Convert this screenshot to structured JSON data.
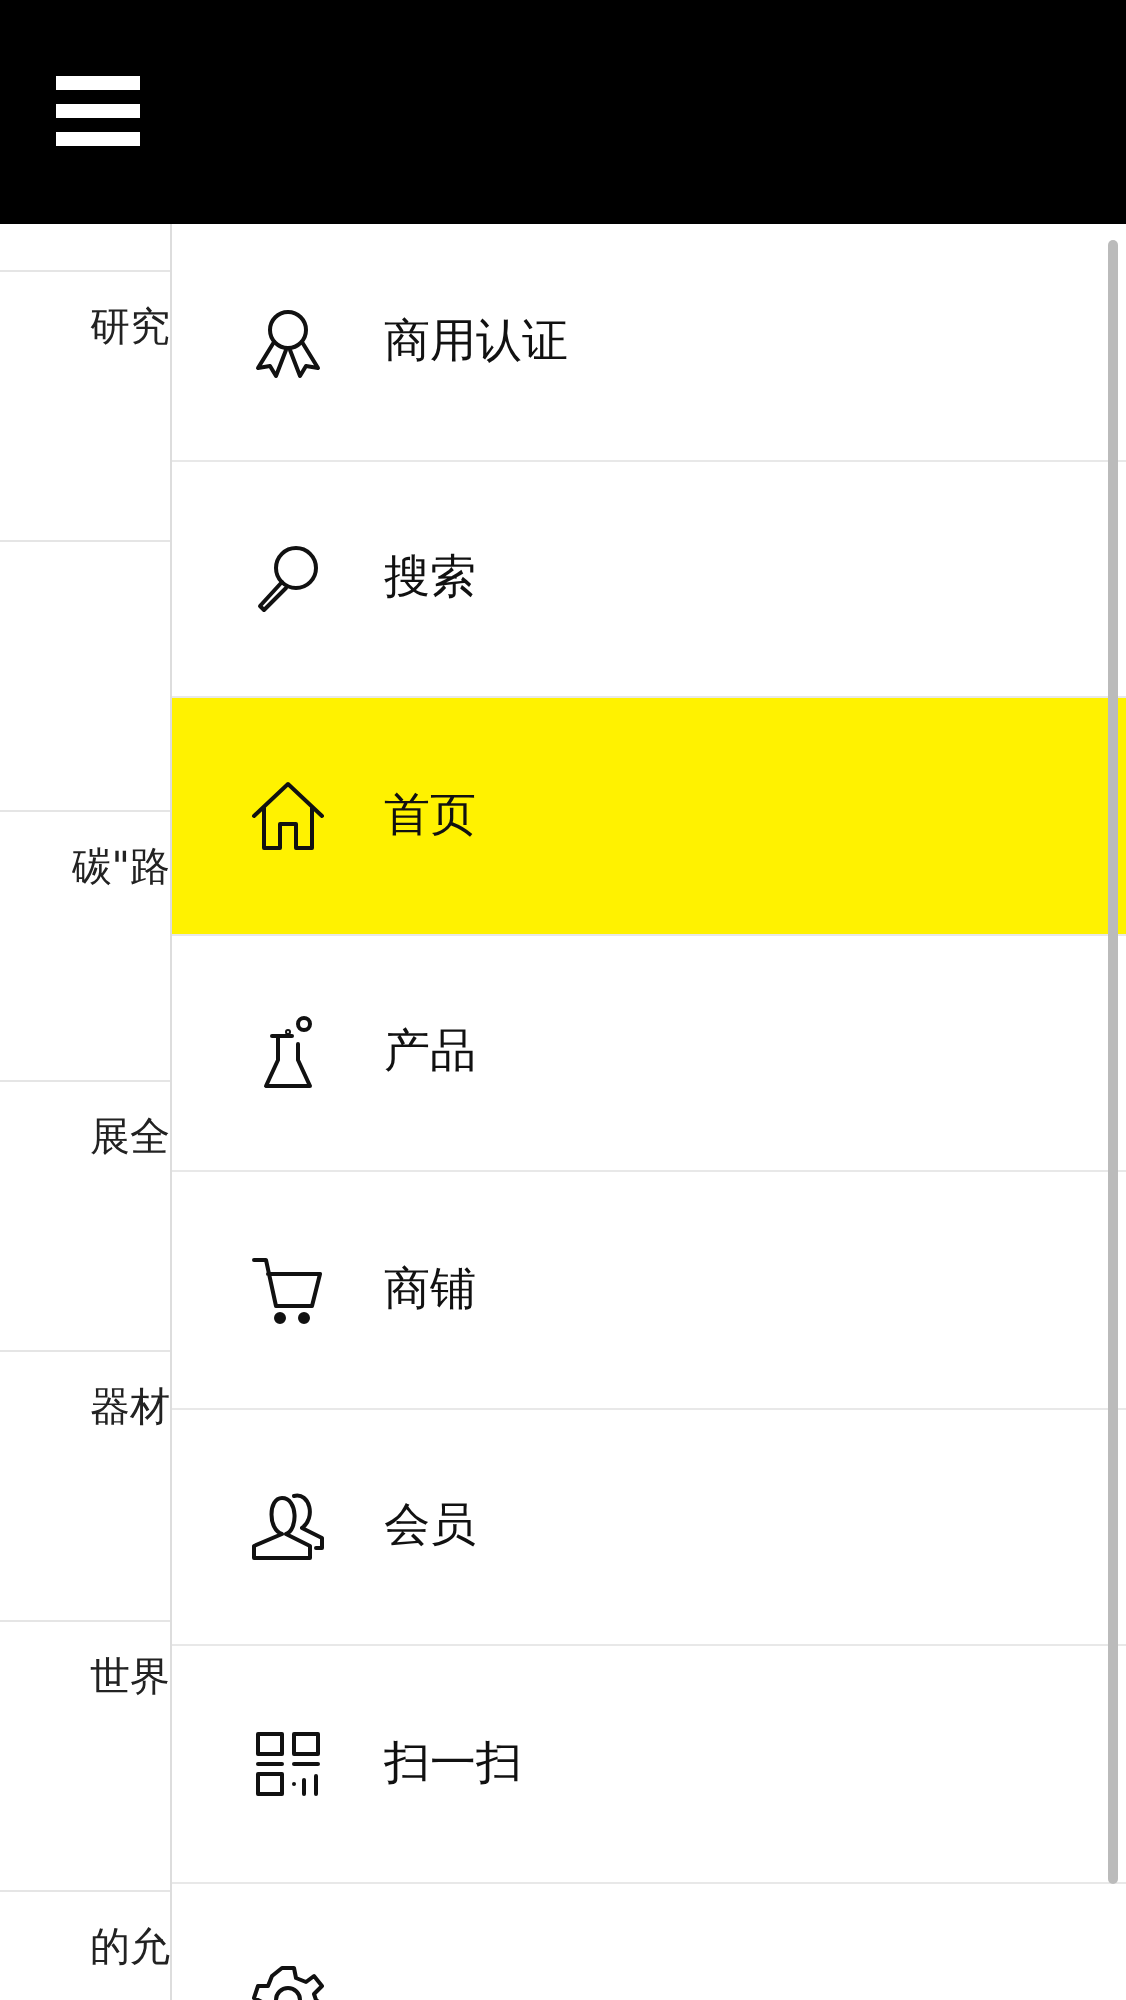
{
  "background_list": [
    {
      "kind": "text",
      "text": "研究"
    },
    {
      "kind": "blank"
    },
    {
      "kind": "text",
      "text": "碳\"路"
    },
    {
      "kind": "text",
      "text": "展全"
    },
    {
      "kind": "text",
      "text": "器材"
    },
    {
      "kind": "text",
      "text": "世界"
    },
    {
      "kind": "text",
      "text": "的允"
    }
  ],
  "menu": [
    {
      "label": "商用认证",
      "selected": false
    },
    {
      "label": "搜索",
      "selected": false
    },
    {
      "label": "首页",
      "selected": true
    },
    {
      "label": "产品",
      "selected": false
    },
    {
      "label": "商铺",
      "selected": false
    },
    {
      "label": "会员",
      "selected": false
    },
    {
      "label": "扫一扫",
      "selected": false
    },
    {
      "selected": false
    }
  ]
}
